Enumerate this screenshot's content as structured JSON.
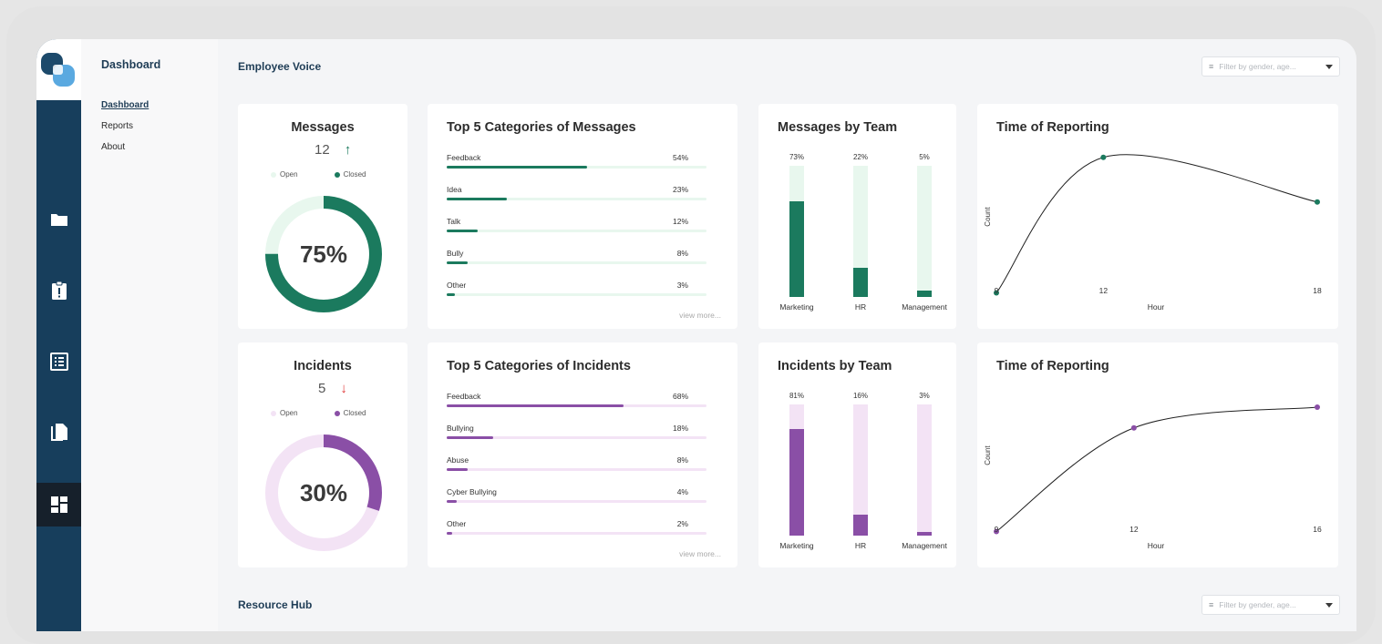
{
  "sidebar": {
    "title": "Dashboard",
    "items": [
      {
        "label": "Dashboard"
      },
      {
        "label": "Reports"
      },
      {
        "label": "About"
      }
    ],
    "rail_icons": [
      "folder-icon",
      "clipboard-alert-icon",
      "list-icon",
      "copy-icon",
      "dashboard-icon"
    ]
  },
  "main": {
    "title": "Employee Voice",
    "filter_placeholder": "Filter by gender, age...",
    "resource_title": "Resource Hub"
  },
  "colors": {
    "messages_dark": "#1b7a5e",
    "messages_light": "#e8f7ee",
    "incidents_dark": "#8a4fa6",
    "incidents_light": "#f3e3f5",
    "rail": "#173e5c"
  },
  "messages": {
    "title": "Messages",
    "count": "12",
    "trend": "↑",
    "legend_open": "Open",
    "legend_closed": "Closed",
    "percent_label": "75%",
    "closed_fraction": 0.75,
    "categories_title": "Top 5 Categories of Messages",
    "categories": [
      {
        "label": "Feedback",
        "pct": "54%",
        "value": 54
      },
      {
        "label": "Idea",
        "pct": "23%",
        "value": 23
      },
      {
        "label": "Talk",
        "pct": "12%",
        "value": 12
      },
      {
        "label": "Bully",
        "pct": "8%",
        "value": 8
      },
      {
        "label": "Other",
        "pct": "3%",
        "value": 3
      }
    ],
    "view_more": "view more...",
    "team_title": "Messages by Team",
    "teams": [
      {
        "name": "Marketing",
        "pct": "73%",
        "value": 73
      },
      {
        "name": "HR",
        "pct": "22%",
        "value": 22
      },
      {
        "name": "Management",
        "pct": "5%",
        "value": 5
      }
    ],
    "time_title": "Time of Reporting"
  },
  "incidents": {
    "title": "Incidents",
    "count": "5",
    "trend": "↓",
    "legend_open": "Open",
    "legend_closed": "Closed",
    "percent_label": "30%",
    "closed_fraction": 0.3,
    "categories_title": "Top 5 Categories of Incidents",
    "categories": [
      {
        "label": "Feedback",
        "pct": "68%",
        "value": 68
      },
      {
        "label": "Bullying",
        "pct": "18%",
        "value": 18
      },
      {
        "label": "Abuse",
        "pct": "8%",
        "value": 8
      },
      {
        "label": "Cyber Bullying",
        "pct": "4%",
        "value": 4
      },
      {
        "label": "Other",
        "pct": "2%",
        "value": 2
      }
    ],
    "view_more": "view more...",
    "team_title": "Incidents by Team",
    "teams": [
      {
        "name": "Marketing",
        "pct": "81%",
        "value": 81
      },
      {
        "name": "HR",
        "pct": "16%",
        "value": 16
      },
      {
        "name": "Management",
        "pct": "3%",
        "value": 3
      }
    ],
    "time_title": "Time of Reporting"
  },
  "chart_data": [
    {
      "type": "line",
      "title": "Time of Reporting",
      "xlabel": "Hour",
      "ylabel": "Count",
      "x": [
        9,
        12,
        18
      ],
      "y": [
        1,
        9.5,
        6.7
      ],
      "ylim": [
        0,
        10
      ],
      "xlim": [
        9,
        18
      ],
      "x_ticks": [
        "9",
        "12",
        "18"
      ],
      "color": "#1b7a5e",
      "grid": false
    },
    {
      "type": "line",
      "title": "Time of Reporting",
      "xlabel": "Hour",
      "ylabel": "Count",
      "x": [
        9,
        12,
        16
      ],
      "y": [
        1,
        7.5,
        8.8
      ],
      "ylim": [
        0,
        10
      ],
      "xlim": [
        9,
        16
      ],
      "x_ticks": [
        "9",
        "12",
        "16"
      ],
      "color": "#8a4fa6",
      "grid": false
    }
  ]
}
